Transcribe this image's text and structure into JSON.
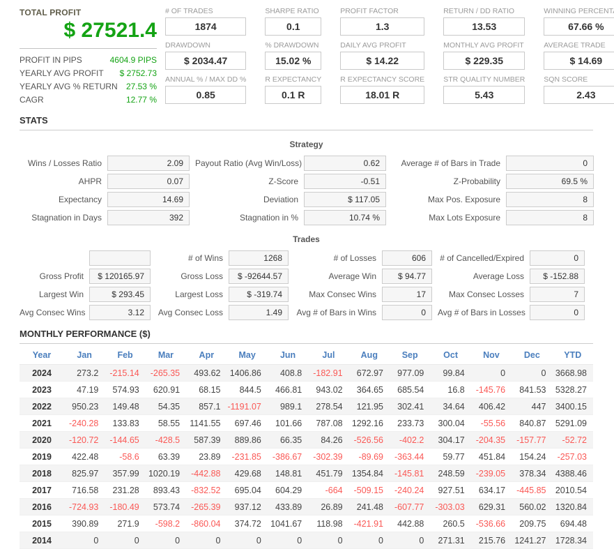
{
  "colors": {
    "profit_green": "#14a314",
    "negative_red": "#fa5855",
    "header_blue": "#4a7ebd"
  },
  "summary": {
    "total_profit_label": "TOTAL PROFIT",
    "total_profit_value": "$ 27521.4",
    "rows": [
      {
        "label": "PROFIT IN PIPS",
        "value": "4604.9 PIPS"
      },
      {
        "label": "YEARLY AVG PROFIT",
        "value": "$ 2752.73"
      },
      {
        "label": "YEARLY AVG % RETURN",
        "value": "27.53 %"
      },
      {
        "label": "CAGR",
        "value": "12.77 %"
      }
    ]
  },
  "metric_rows": [
    [
      {
        "label": "# OF TRADES",
        "value": "1874"
      },
      {
        "label": "SHARPE RATIO",
        "value": "0.1"
      },
      {
        "label": "PROFIT FACTOR",
        "value": "1.3"
      },
      {
        "label": "RETURN / DD RATIO",
        "value": "13.53"
      },
      {
        "label": "WINNING PERCENTAGE",
        "value": "67.66 %"
      }
    ],
    [
      {
        "label": "DRAWDOWN",
        "value": "$ 2034.47"
      },
      {
        "label": "% DRAWDOWN",
        "value": "15.02 %"
      },
      {
        "label": "DAILY AVG PROFIT",
        "value": "$ 14.22"
      },
      {
        "label": "MONTHLY AVG PROFIT",
        "value": "$ 229.35"
      },
      {
        "label": "AVERAGE TRADE",
        "value": "$ 14.69"
      }
    ],
    [
      {
        "label": "ANNUAL % / MAX DD %",
        "value": "0.85"
      },
      {
        "label": "R EXPECTANCY",
        "value": "0.1 R"
      },
      {
        "label": "R EXPECTANCY SCORE",
        "value": "18.01 R"
      },
      {
        "label": "STR QUALITY NUMBER",
        "value": "5.43"
      },
      {
        "label": "SQN SCORE",
        "value": "2.43"
      }
    ]
  ],
  "stats": {
    "heading": "STATS",
    "strategy": {
      "title": "Strategy",
      "rows": [
        [
          {
            "label": "Wins / Losses Ratio",
            "value": "2.09"
          },
          {
            "label": "Payout Ratio (Avg Win/Loss)",
            "value": "0.62"
          },
          {
            "label": "Average # of Bars in Trade",
            "value": "0"
          }
        ],
        [
          {
            "label": "AHPR",
            "value": "0.07"
          },
          {
            "label": "Z-Score",
            "value": "-0.51"
          },
          {
            "label": "Z-Probability",
            "value": "69.5 %"
          }
        ],
        [
          {
            "label": "Expectancy",
            "value": "14.69"
          },
          {
            "label": "Deviation",
            "value": "$ 117.05"
          },
          {
            "label": "Max Pos. Exposure",
            "value": "8"
          }
        ],
        [
          {
            "label": "Stagnation in Days",
            "value": "392"
          },
          {
            "label": "Stagnation in %",
            "value": "10.74 %"
          },
          {
            "label": "Max Lots Exposure",
            "value": "8"
          }
        ]
      ]
    },
    "trades": {
      "title": "Trades",
      "rows": [
        [
          {
            "label": "",
            "value": ""
          },
          {
            "label": "# of Wins",
            "value": "1268"
          },
          {
            "label": "# of Losses",
            "value": "606"
          },
          {
            "label": "# of Cancelled/Expired",
            "value": "0"
          }
        ],
        [
          {
            "label": "Gross Profit",
            "value": "$ 120165.97"
          },
          {
            "label": "Gross Loss",
            "value": "$ -92644.57"
          },
          {
            "label": "Average Win",
            "value": "$ 94.77"
          },
          {
            "label": "Average Loss",
            "value": "$ -152.88"
          }
        ],
        [
          {
            "label": "Largest Win",
            "value": "$ 293.45"
          },
          {
            "label": "Largest Loss",
            "value": "$ -319.74"
          },
          {
            "label": "Max Consec Wins",
            "value": "17"
          },
          {
            "label": "Max Consec Losses",
            "value": "7"
          }
        ],
        [
          {
            "label": "Avg Consec Wins",
            "value": "3.12"
          },
          {
            "label": "Avg Consec Loss",
            "value": "1.49"
          },
          {
            "label": "Avg # of Bars in Wins",
            "value": "0"
          },
          {
            "label": "Avg # of Bars in Losses",
            "value": "0"
          }
        ]
      ]
    }
  },
  "monthly": {
    "heading": "MONTHLY PERFORMANCE ($)",
    "columns": [
      "Year",
      "Jan",
      "Feb",
      "Mar",
      "Apr",
      "May",
      "Jun",
      "Jul",
      "Aug",
      "Sep",
      "Oct",
      "Nov",
      "Dec",
      "YTD"
    ],
    "rows": [
      [
        "2024",
        "273.2",
        "-215.14",
        "-265.35",
        "493.62",
        "1406.86",
        "408.8",
        "-182.91",
        "672.97",
        "977.09",
        "99.84",
        "0",
        "0",
        "3668.98"
      ],
      [
        "2023",
        "47.19",
        "574.93",
        "620.91",
        "68.15",
        "844.5",
        "466.81",
        "943.02",
        "364.65",
        "685.54",
        "16.8",
        "-145.76",
        "841.53",
        "5328.27"
      ],
      [
        "2022",
        "950.23",
        "149.48",
        "54.35",
        "857.1",
        "-1191.07",
        "989.1",
        "278.54",
        "121.95",
        "302.41",
        "34.64",
        "406.42",
        "447",
        "3400.15"
      ],
      [
        "2021",
        "-240.28",
        "133.83",
        "58.55",
        "1141.55",
        "697.46",
        "101.66",
        "787.08",
        "1292.16",
        "233.73",
        "300.04",
        "-55.56",
        "840.87",
        "5291.09"
      ],
      [
        "2020",
        "-120.72",
        "-144.65",
        "-428.5",
        "587.39",
        "889.86",
        "66.35",
        "84.26",
        "-526.56",
        "-402.2",
        "304.17",
        "-204.35",
        "-157.77",
        "-52.72"
      ],
      [
        "2019",
        "422.48",
        "-58.6",
        "63.39",
        "23.89",
        "-231.85",
        "-386.67",
        "-302.39",
        "-89.69",
        "-363.44",
        "59.77",
        "451.84",
        "154.24",
        "-257.03"
      ],
      [
        "2018",
        "825.97",
        "357.99",
        "1020.19",
        "-442.88",
        "429.68",
        "148.81",
        "451.79",
        "1354.84",
        "-145.81",
        "248.59",
        "-239.05",
        "378.34",
        "4388.46"
      ],
      [
        "2017",
        "716.58",
        "231.28",
        "893.43",
        "-832.52",
        "695.04",
        "604.29",
        "-664",
        "-509.15",
        "-240.24",
        "927.51",
        "634.17",
        "-445.85",
        "2010.54"
      ],
      [
        "2016",
        "-724.93",
        "-180.49",
        "573.74",
        "-265.39",
        "937.12",
        "433.89",
        "26.89",
        "241.48",
        "-607.77",
        "-303.03",
        "629.31",
        "560.02",
        "1320.84"
      ],
      [
        "2015",
        "390.89",
        "271.9",
        "-598.2",
        "-860.04",
        "374.72",
        "1041.67",
        "118.98",
        "-421.91",
        "442.88",
        "260.5",
        "-536.66",
        "209.75",
        "694.48"
      ],
      [
        "2014",
        "0",
        "0",
        "0",
        "0",
        "0",
        "0",
        "0",
        "0",
        "0",
        "271.31",
        "215.76",
        "1241.27",
        "1728.34"
      ]
    ]
  }
}
